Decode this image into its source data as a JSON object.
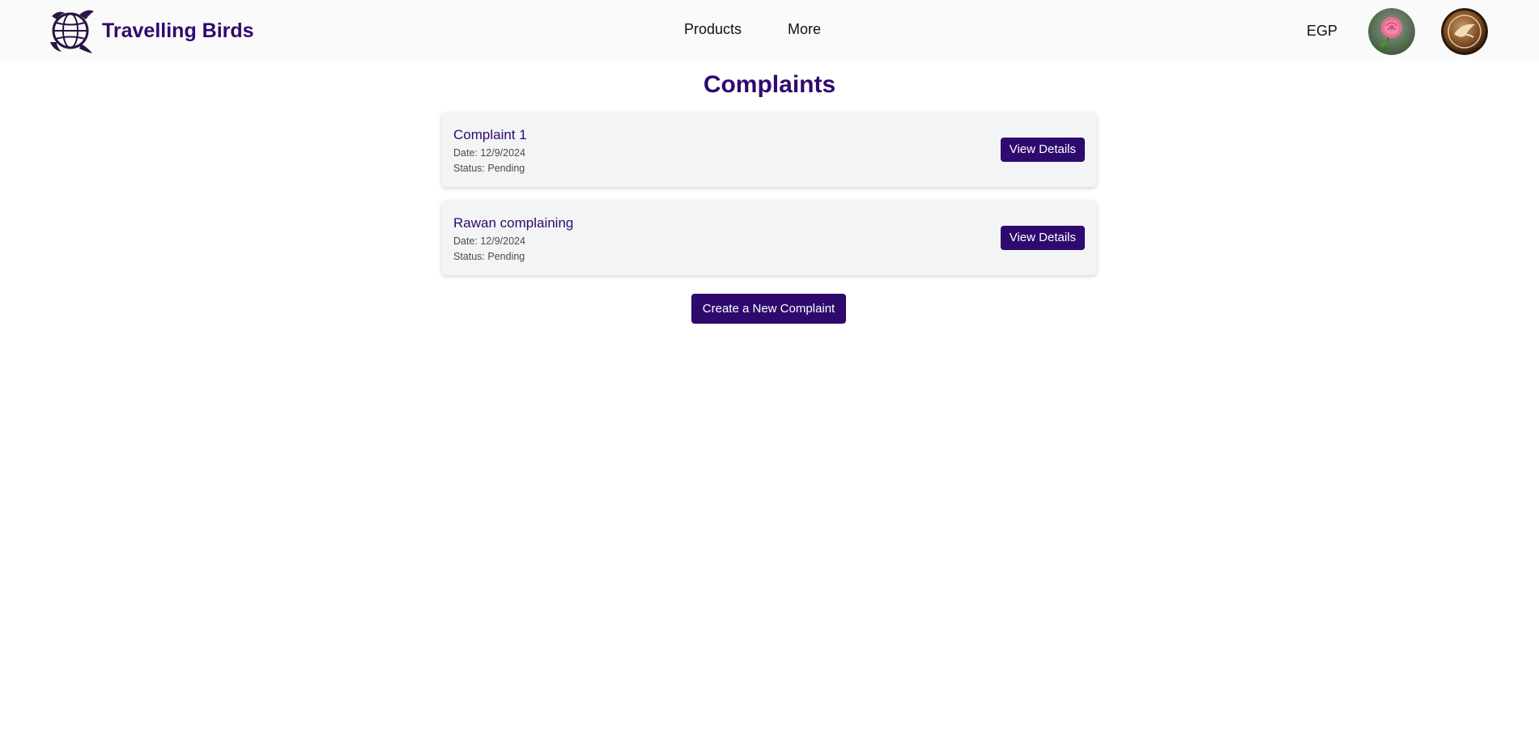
{
  "brand": {
    "name": "Travelling Birds",
    "logo_icon": "globe-birds-logo"
  },
  "nav": {
    "links": [
      {
        "label": "Products"
      },
      {
        "label": "More"
      }
    ],
    "currency": "EGP",
    "avatars": [
      {
        "icon": "rose-avatar"
      },
      {
        "icon": "coin-avatar"
      }
    ]
  },
  "page": {
    "title": "Complaints"
  },
  "complaints": [
    {
      "title": "Complaint 1",
      "date": "Date: 12/9/2024",
      "status": "Status: Pending",
      "button_label": "View Details"
    },
    {
      "title": "Rawan complaining",
      "date": "Date: 12/9/2024",
      "status": "Status: Pending",
      "button_label": "View Details"
    }
  ],
  "actions": {
    "create_label": "Create a New Complaint"
  },
  "colors": {
    "brand": "#2e0a6e",
    "card_bg": "#f3f4f6",
    "navbar_bg": "#fafafa"
  }
}
